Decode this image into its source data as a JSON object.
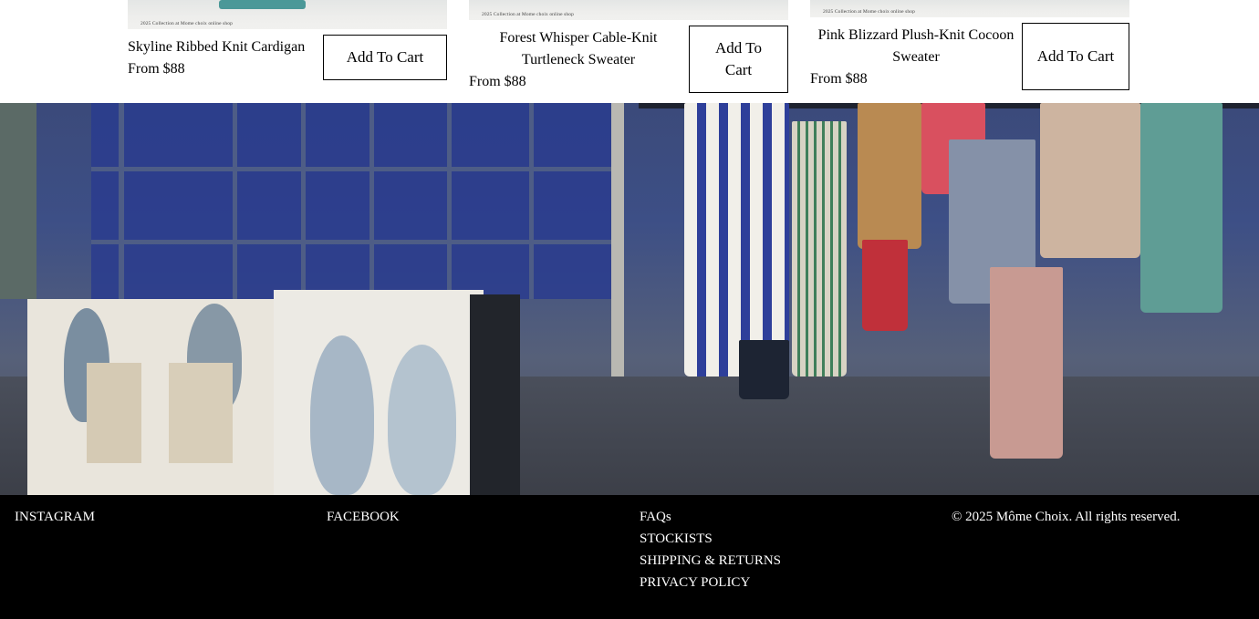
{
  "products": [
    {
      "name": "Skyline Ribbed Knit Cardigan",
      "price": "From $88",
      "button": "Add To Cart",
      "image_caption": "2025 Collection at Mome choix online shop"
    },
    {
      "name": "Forest Whisper Cable-Knit Turtleneck Sweater",
      "price": "From $88",
      "button": "Add To Cart",
      "image_caption": "2025 Collection at Mome choix online shop"
    },
    {
      "name": "Pink Blizzard Plush-Knit Cocoon Sweater",
      "price": "From $88",
      "button": "Add To Cart",
      "image_caption": "2025 Collection at Mome choix online shop"
    }
  ],
  "footer": {
    "social": [
      "INSTAGRAM",
      "FACEBOOK"
    ],
    "links": [
      "FAQs",
      "STOCKISTS",
      "SHIPPING & RETURNS",
      "PRIVACY POLICY"
    ],
    "copyright": "© 2025 Môme Choix. All rights reserved."
  },
  "colors": {
    "footer_bg": "#000000",
    "footer_text": "#ffffff",
    "button_border": "#000000"
  }
}
